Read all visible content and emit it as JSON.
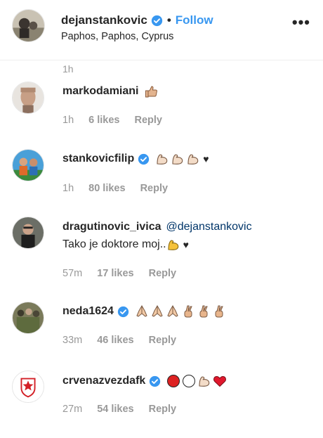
{
  "header": {
    "username": "dejanstankovic",
    "separator": "•",
    "follow_label": "Follow",
    "location": "Paphos, Paphos, Cyprus",
    "more_label": "•••"
  },
  "top_time": "1h",
  "comments": [
    {
      "username": "markodamiani",
      "verified": false,
      "emojis": [
        "thumbs-up"
      ],
      "time": "1h",
      "likes": "6 likes",
      "reply": "Reply"
    },
    {
      "username": "stankovicfilip",
      "verified": true,
      "emojis": [
        "flexed-biceps",
        "flexed-biceps",
        "flexed-biceps",
        "black-heart"
      ],
      "time": "1h",
      "likes": "80 likes",
      "reply": "Reply"
    },
    {
      "username": "dragutinovic_ivica",
      "verified": false,
      "mention": "@dejanstankovic",
      "text": "Tako je doktore moj..",
      "emojis": [
        "flexed-biceps",
        "black-heart"
      ],
      "time": "57m",
      "likes": "17 likes",
      "reply": "Reply"
    },
    {
      "username": "neda1624",
      "verified": true,
      "emojis": [
        "folded-hands",
        "folded-hands",
        "folded-hands",
        "crossed-fingers",
        "crossed-fingers",
        "crossed-fingers"
      ],
      "time": "33m",
      "likes": "46 likes",
      "reply": "Reply"
    },
    {
      "username": "crvenazvezdafk",
      "verified": true,
      "emojis": [
        "red-circle",
        "white-circle",
        "flexed-biceps",
        "red-heart"
      ],
      "time": "27m",
      "likes": "54 likes",
      "reply": "Reply"
    }
  ],
  "colors": {
    "link_blue": "#3897f0",
    "verified_blue": "#3897f0",
    "meta_gray": "#999999",
    "text": "#262626"
  }
}
